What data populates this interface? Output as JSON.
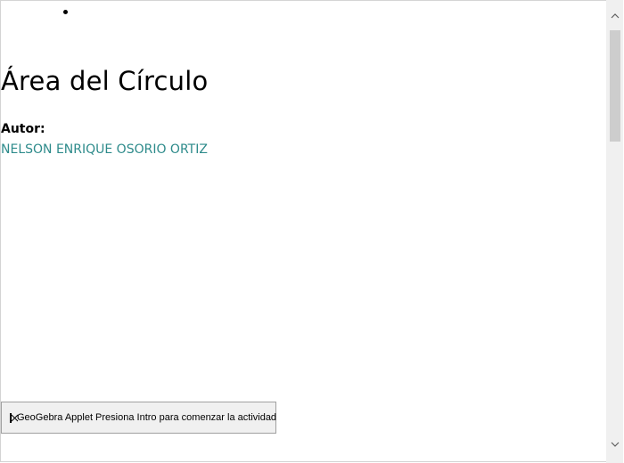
{
  "page": {
    "title": "Área del Círculo",
    "author_label": "Autor:",
    "author_name": "NELSON ENRIQUE OSORIO ORTIZ"
  },
  "applet": {
    "placeholder_text": "GeoGebra Applet Presiona Intro para comenzar la actividad",
    "icon": "broken-image-icon"
  },
  "scrollbar": {
    "up_icon": "chevron-up-icon",
    "down_icon": "chevron-down-icon"
  },
  "colors": {
    "link": "#2e8b8b",
    "text": "#000000",
    "applet_bg": "#f0f0f0"
  }
}
